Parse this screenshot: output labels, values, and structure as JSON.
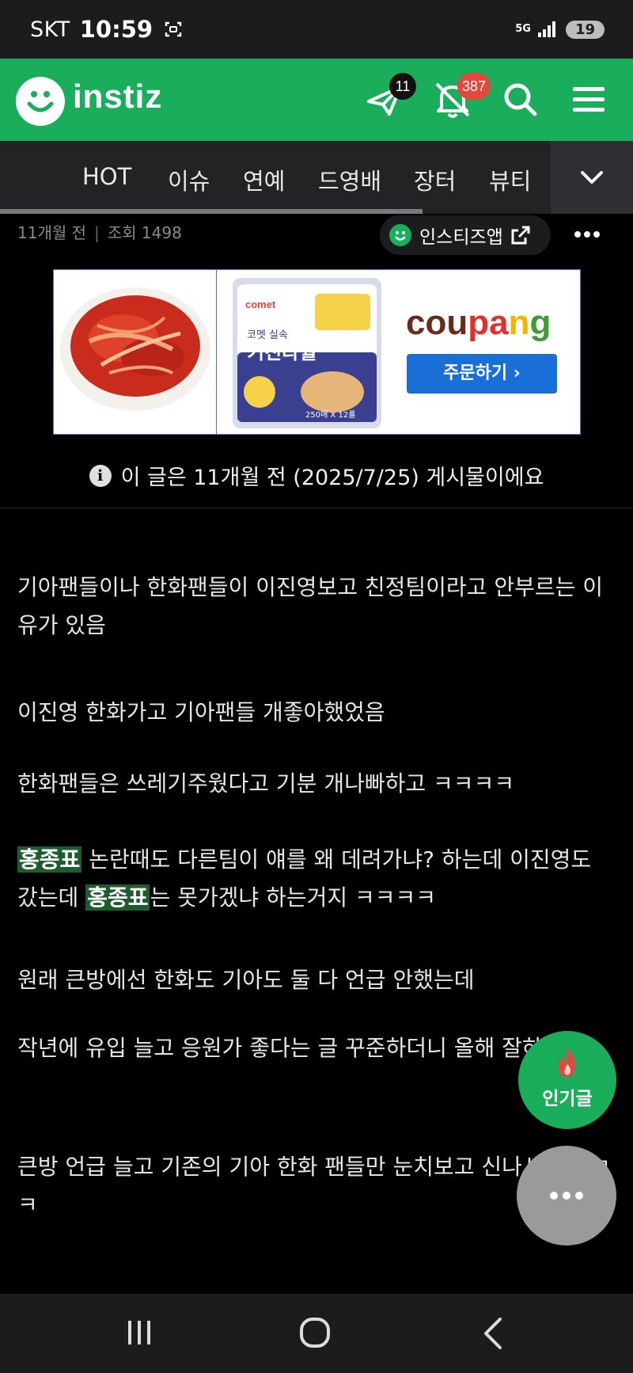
{
  "status_bar": {
    "carrier": "SKT",
    "time": "10:59",
    "network": "5G",
    "battery": "19",
    "icons": [
      "screenshot-icon",
      "signal-icon"
    ]
  },
  "header": {
    "logo_text": "instiz",
    "message_badge": "11",
    "notification_badge": "387",
    "icons": [
      "paper-plane-icon",
      "bell-off-icon",
      "search-icon",
      "menu-icon"
    ],
    "brand_color": "#1aad5b"
  },
  "category_nav": {
    "items": [
      "HOT",
      "이슈",
      "연예",
      "드영배",
      "장터",
      "뷰티"
    ],
    "more_icon": "chevron-down-icon"
  },
  "meta": {
    "time_ago": "11개월 전",
    "views": "조회 1498",
    "app_button_label": "인스티즈앱"
  },
  "ad": {
    "product_label_1": "코멧 실속",
    "product_label_2": "키친타월",
    "product_small": "250매 X 12롤",
    "brand_parts": [
      "cou",
      "pa",
      "n",
      "g"
    ],
    "brand_colors": [
      "#6a2b1a",
      "#e52f2f",
      "#f4b400",
      "#3f9c35"
    ],
    "cta_label": "주문하기 ›"
  },
  "notice": {
    "icon": "info-icon",
    "text": "이 글은 11개월 전 (2025/7/25) 게시물이에요"
  },
  "article": {
    "p1": "기아팬들이나 한화팬들이 이진영보고 친정팀이라고 안부르는 이유가 있음",
    "p2": "이진영 한화가고 기아팬들 개좋아했었음",
    "p3": "한화팬들은 쓰레기주웠다고 기분 개나빠하고 ㅋㅋㅋㅋ",
    "p4_highlight": "홍종표",
    "p4_a": " 논란때도 다른팀이 얘를 왜 데려가냐? 하는데 이진영도 갔는데 ",
    "p4_b": "는 못가겠냐 하는거지 ㅋㅋㅋㅋ",
    "p5": "원래 큰방에선 한화도 기아도 둘 다 언급 안했는데",
    "p6": "작년에 유입 늘고 응원가 좋다는 글 꾸준하더니 올해 잘하니깐",
    "p7": "큰방 언급 늘고 기존의 기아 한화 팬들만 눈치보고 신나서 글씀ㅋㅋ"
  },
  "fab": {
    "popular_label": "인기글",
    "popular_icon": "fire-icon",
    "more_icon": "more-dots-icon"
  },
  "nav_bar": {
    "icons": [
      "recent-apps-icon",
      "home-icon",
      "back-icon"
    ]
  }
}
